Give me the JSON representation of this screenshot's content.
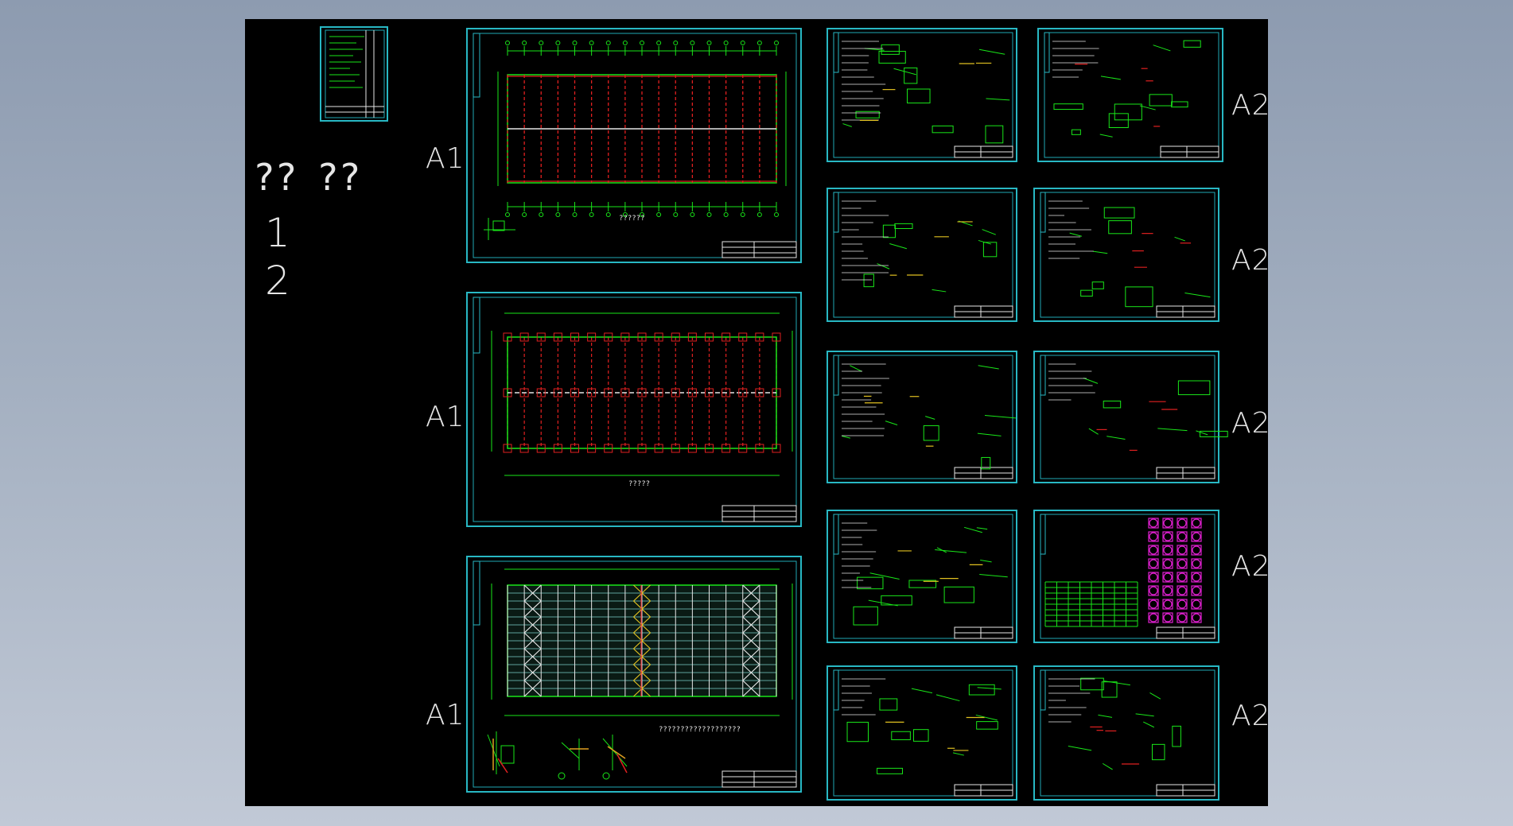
{
  "left_labels": {
    "q1": "??",
    "q2": "??",
    "n1": "1",
    "n2": "2"
  },
  "column1_labels": [
    "A1",
    "A1",
    "A1"
  ],
  "column2_labels": [
    "A2",
    "A2",
    "A2",
    "A2",
    "A2"
  ],
  "plan_titles": [
    "??????",
    "?????",
    "???????????????????"
  ],
  "colors": {
    "background": "#000000",
    "frame": "#28b8c4",
    "grid": "#19e619",
    "axis": "#e02020",
    "text": "#e6e6e6",
    "magenta": "#e020d0"
  }
}
